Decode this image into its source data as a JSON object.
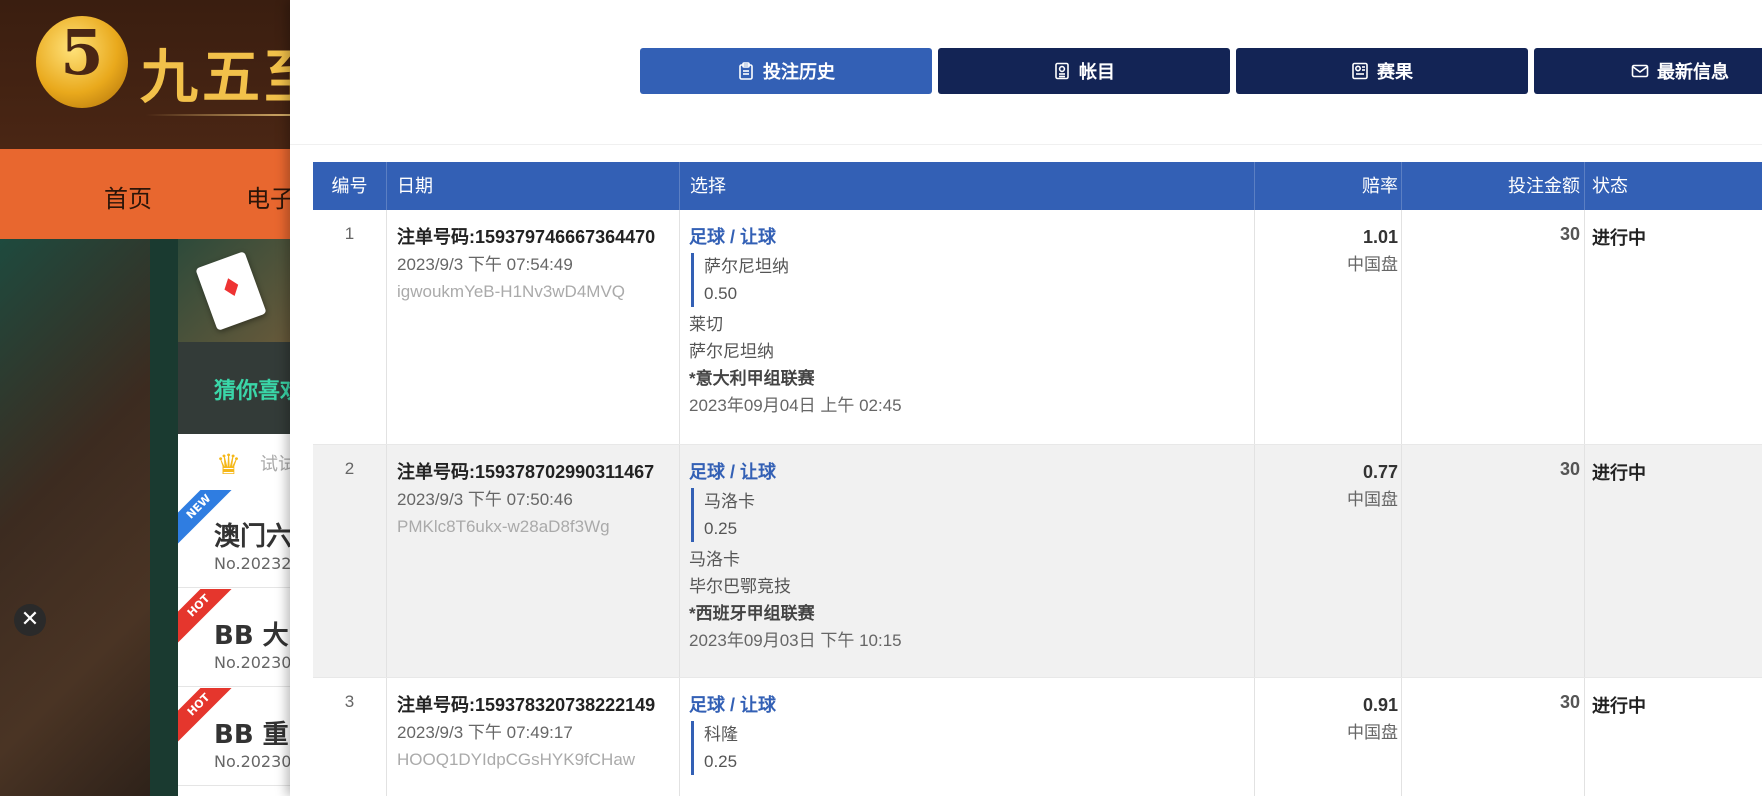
{
  "background": {
    "logo_number": "5",
    "logo_text": "九五至",
    "nav": [
      "首页",
      "电子"
    ],
    "guess_text": "猜你喜欢",
    "try_text": "试试",
    "list": [
      {
        "badge": "NEW",
        "title": "澳门六",
        "no": "No.20232"
      },
      {
        "badge": "HOT",
        "title": "BB 大",
        "no": "No.20230"
      },
      {
        "badge": "HOT",
        "title": "BB 重",
        "no": "No.20230"
      }
    ],
    "close_symbol": "✕"
  },
  "tabs": [
    {
      "label": "投注历史",
      "icon": "clipboard-icon",
      "active": true
    },
    {
      "label": "帐目",
      "icon": "ledger-icon",
      "active": false
    },
    {
      "label": "赛果",
      "icon": "scoreboard-icon",
      "active": false
    },
    {
      "label": "最新信息",
      "icon": "mail-icon",
      "active": false
    }
  ],
  "table": {
    "headers": {
      "no": "编号",
      "date": "日期",
      "selection": "选择",
      "odds": "赔率",
      "amount": "投注金额",
      "status": "状态"
    },
    "rows": [
      {
        "no": "1",
        "ticket": "注单号码:159379746667364470",
        "datetime": "2023/9/3 下午 07:54:49",
        "hash": "igwoukmYeB-H1Nv3wD4MVQ",
        "sport": "足球 / 让球",
        "pick_team": "萨尔尼坦纳",
        "pick_line": "0.50",
        "home": "莱切",
        "away": "萨尔尼坦纳",
        "league": "*意大利甲组联赛",
        "match_date": "2023年09月04日 上午 02:45",
        "odds": "1.01",
        "odds_type": "中国盘",
        "amount": "30",
        "status": "进行中"
      },
      {
        "no": "2",
        "ticket": "注单号码:159378702990311467",
        "datetime": "2023/9/3 下午 07:50:46",
        "hash": "PMKlc8T6ukx-w28aD8f3Wg",
        "sport": "足球 / 让球",
        "pick_team": "马洛卡",
        "pick_line": "0.25",
        "home": "马洛卡",
        "away": "毕尔巴鄂竞技",
        "league": "*西班牙甲组联赛",
        "match_date": "2023年09月03日 下午 10:15",
        "odds": "0.77",
        "odds_type": "中国盘",
        "amount": "30",
        "status": "进行中"
      },
      {
        "no": "3",
        "ticket": "注单号码:159378320738222149",
        "datetime": "2023/9/3 下午 07:49:17",
        "hash": "HOOQ1DYIdpCGsHYK9fCHaw",
        "sport": "足球 / 让球",
        "pick_team": "科隆",
        "pick_line": "0.25",
        "odds": "0.91",
        "odds_type": "中国盘",
        "amount": "30",
        "status": "进行中"
      }
    ]
  },
  "colors": {
    "accent": "#3360b5",
    "tab_dark": "#132455",
    "nav_orange": "#e8672f",
    "row_alt": "#f1f1f1"
  }
}
